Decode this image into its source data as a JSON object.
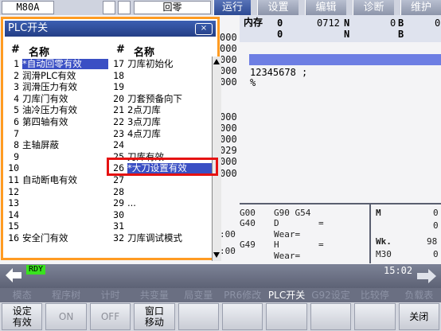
{
  "topbar": {
    "machine": "M80A",
    "mode": "回零",
    "tabs": [
      {
        "label": "运行",
        "active": true
      },
      {
        "label": "设置",
        "active": false
      },
      {
        "label": "编辑",
        "active": false
      },
      {
        "label": "诊断",
        "active": false
      },
      {
        "label": "维护",
        "active": false
      }
    ]
  },
  "background": {
    "memory_label": "内存",
    "hdr_values": [
      "0",
      "0712",
      "N",
      "0",
      "B",
      "0",
      "0",
      "N",
      "B"
    ],
    "side_numbers": [
      "000",
      "000",
      "000",
      "000",
      "000",
      "000",
      "000",
      "000",
      "000",
      "029",
      "000",
      "000",
      "000"
    ],
    "program_line": "12345678 ;",
    "program_pct": "%",
    "gcode": {
      "g1": "G00",
      "g2": "G90 G54",
      "g3": "G40",
      "d_label": "D",
      "d_eq": "=",
      "wear1": "Wear=",
      "g4": "G49",
      "h_label": "H",
      "h_eq": "=",
      "wear2": "Wear=",
      "m_label": "M",
      "m_val": "0",
      "m_val2": "0",
      "wk_label": "Wk.",
      "wk_val": "98",
      "m30_label": "M30",
      "m30_val": "0",
      "edge_nums": [
        ":00",
        ":00"
      ]
    }
  },
  "dialog": {
    "title": "PLC开关",
    "close": "×",
    "col_hash": "#",
    "col_name": "名称",
    "left_rows": [
      {
        "n": "1",
        "name": "*自动回零有效"
      },
      {
        "n": "2",
        "name": "润滑PLC有效"
      },
      {
        "n": "3",
        "name": "润滑压力有效"
      },
      {
        "n": "4",
        "name": "刀库门有效"
      },
      {
        "n": "5",
        "name": "油冷压力有效"
      },
      {
        "n": "6",
        "name": "第四轴有效"
      },
      {
        "n": "7",
        "name": ""
      },
      {
        "n": "8",
        "name": "主轴屏蔽"
      },
      {
        "n": "9",
        "name": ""
      },
      {
        "n": "10",
        "name": ""
      },
      {
        "n": "11",
        "name": "自动断电有效"
      },
      {
        "n": "12",
        "name": ""
      },
      {
        "n": "13",
        "name": ""
      },
      {
        "n": "14",
        "name": ""
      },
      {
        "n": "15",
        "name": ""
      },
      {
        "n": "16",
        "name": "安全门有效"
      }
    ],
    "right_rows": [
      {
        "n": "17",
        "name": "刀库初始化"
      },
      {
        "n": "18",
        "name": ""
      },
      {
        "n": "19",
        "name": ""
      },
      {
        "n": "20",
        "name": "刀套预备向下"
      },
      {
        "n": "21",
        "name": "2点刀库"
      },
      {
        "n": "22",
        "name": "3点刀库"
      },
      {
        "n": "23",
        "name": "4点刀库"
      },
      {
        "n": "24",
        "name": ""
      },
      {
        "n": "25",
        "name": "刀库有效"
      },
      {
        "n": "26",
        "name": "*大刀设置有效"
      },
      {
        "n": "27",
        "name": ""
      },
      {
        "n": "28",
        "name": ""
      },
      {
        "n": "29",
        "name": "..."
      },
      {
        "n": "30",
        "name": ""
      },
      {
        "n": "31",
        "name": ""
      },
      {
        "n": "32",
        "name": "刀库调试模式"
      }
    ]
  },
  "status": {
    "rdy": "RDY",
    "time": "15:02"
  },
  "softkeys": [
    {
      "label": "模态",
      "on": false
    },
    {
      "label": "程序树",
      "on": false
    },
    {
      "label": "计时",
      "on": false
    },
    {
      "label": "共变量",
      "on": false
    },
    {
      "label": "局变量",
      "on": false
    },
    {
      "label": "PR6修改",
      "on": false
    },
    {
      "label": "PLC开关",
      "on": true
    },
    {
      "label": "G92设定",
      "on": false
    },
    {
      "label": "比较停",
      "on": false
    },
    {
      "label": "负载表",
      "on": false
    }
  ],
  "function_keys": [
    {
      "line1": "设定",
      "line2": "有效",
      "dim": false
    },
    {
      "line1": "ON",
      "line2": "",
      "dim": true
    },
    {
      "line1": "OFF",
      "line2": "",
      "dim": true
    },
    {
      "line1": "窗口",
      "line2": "移动",
      "dim": false
    },
    {
      "line1": "",
      "line2": "",
      "dim": false
    },
    {
      "line1": "",
      "line2": "",
      "dim": false
    },
    {
      "line1": "",
      "line2": "",
      "dim": false
    },
    {
      "line1": "",
      "line2": "",
      "dim": false
    },
    {
      "line1": "",
      "line2": "",
      "dim": false
    },
    {
      "line1": "关闭",
      "line2": "",
      "dim": false
    }
  ]
}
